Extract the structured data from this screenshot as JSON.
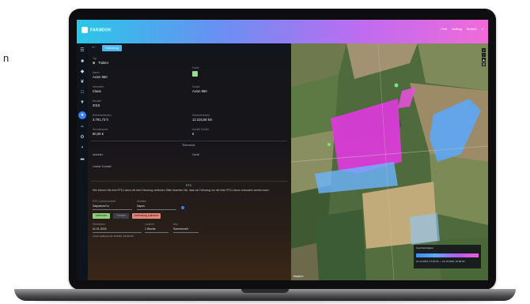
{
  "side_text": "n",
  "app": {
    "logo": "FARMDOK",
    "topbar_right": [
      "Feld",
      "Auftrag",
      "Betrieb"
    ]
  },
  "nav": {
    "icons": [
      "menu-icon",
      "tractor-icon",
      "map-pin-icon",
      "leaf-icon",
      "clipboard-icon",
      "filter-icon",
      "activity-icon",
      "settings-icon",
      "chart-icon",
      "document-icon",
      "user-icon"
    ]
  },
  "tab": {
    "label": "Fahrzeug"
  },
  "vehicle": {
    "type_label": "Typ",
    "type_value": "Traktor",
    "name_label": "Name",
    "name_value": "Axion 950",
    "color_label": "Farbe",
    "manufacturer_label": "Hersteller",
    "manufacturer_value": "Claas",
    "model_label": "Modell",
    "model_value": "Axion 950",
    "year_label": "Baujahr",
    "year_value": "2015",
    "hours_label": "Betriebsstunden",
    "hours_value": "3.791,73 h",
    "km_label": "Kilometerstand",
    "km_value": "12.315,56 km",
    "price_label": "Stundenpreis",
    "price_value": "80,00 €",
    "count_label": "Anzahl Geräte",
    "count_value": "6"
  },
  "telemetry": {
    "title": "Telemetrie",
    "field_a": "Anbieter",
    "field_b": "Gerät",
    "field_c": "Letzter Kontakt"
  },
  "rtk": {
    "title": "RTK",
    "description": "Hier können Sie eine RTK-Lizenz mit dem Fahrzeug verbinden. Bitte beachten Sie, dass ein Fahrzeug nur mit einer RTK-Lizenz verbunden werden kann.",
    "license_label": "RTK-Lizenznummer",
    "license_value": "SatpartnerCo",
    "provider_label": "Anbieter",
    "provider_value": "Sapos",
    "btn_connect": "Verbinden",
    "btn_disconnect": "Trennen",
    "btn_delete": "Verbindung aufheben",
    "start_label": "Startdatum",
    "start_value": "01.01.2024",
    "duration_label": "Laufzeit",
    "duration_value": "1 Woche",
    "plan_label": "Abo",
    "plan_value": "Sommerzeit",
    "footnote": "Lizenz gültig bis 01.10.2024, 23:59 Uhr"
  },
  "map": {
    "legend_label": "Geschwindigkeit",
    "legend_range": "01.10.2024, 07:30:00 — 01.10.2024, 22:30:00",
    "logo": "Mapbox"
  }
}
